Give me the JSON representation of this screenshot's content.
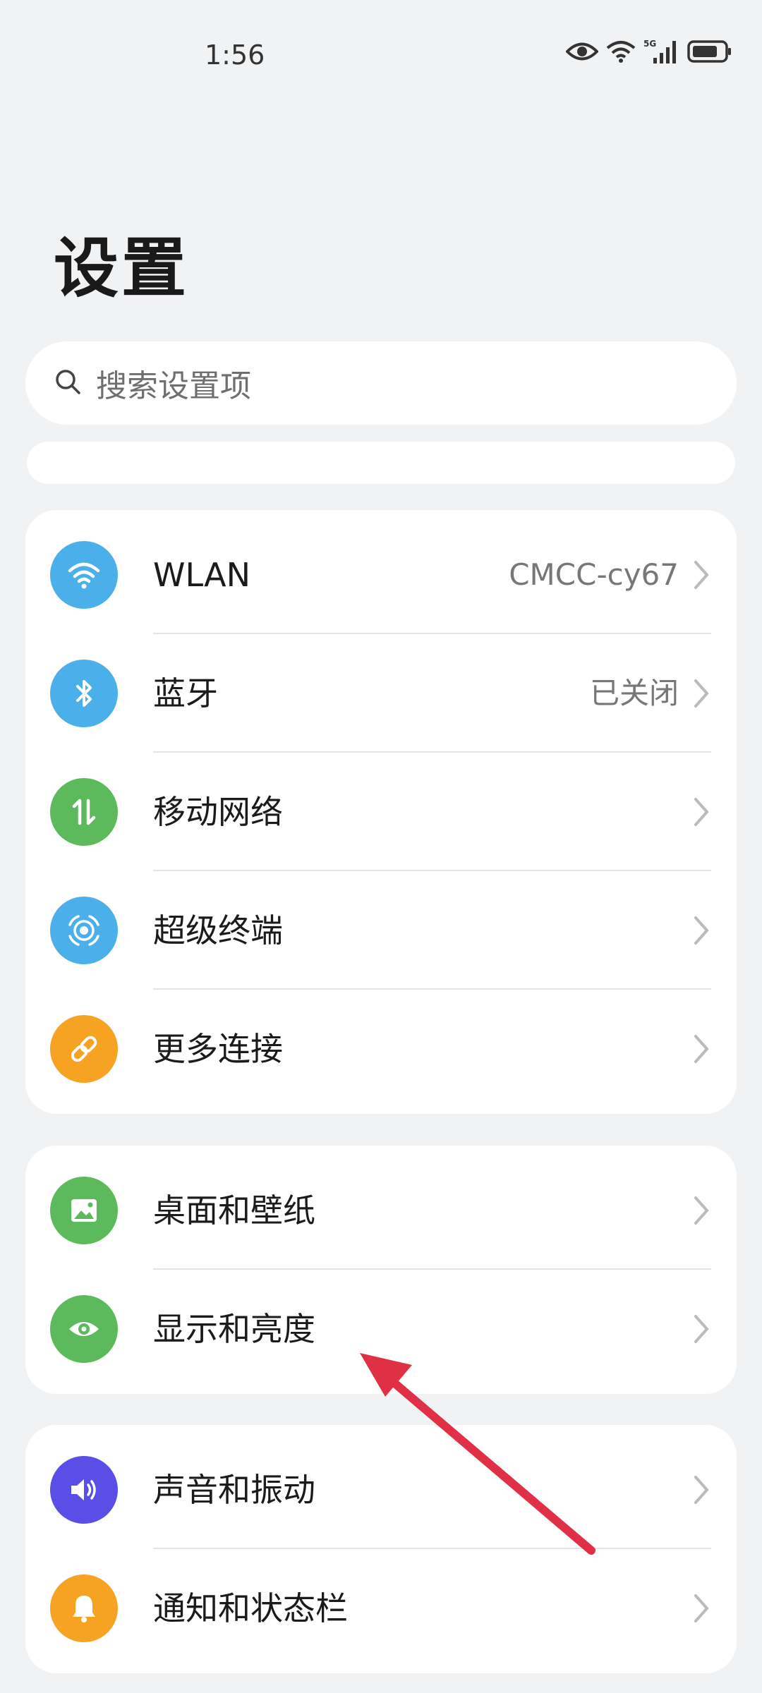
{
  "status_bar": {
    "time": "1:56",
    "network": "5G",
    "icons": [
      "eye-icon",
      "wifi-icon",
      "signal-icon",
      "battery-icon"
    ]
  },
  "page": {
    "title": "设置"
  },
  "search": {
    "placeholder": "搜索设置项"
  },
  "groups": [
    {
      "items": [
        {
          "label": "WLAN",
          "value": "CMCC-cy67",
          "icon": "wifi-icon",
          "color": "#4bb0ea"
        },
        {
          "label": "蓝牙",
          "value": "已关闭",
          "icon": "bluetooth-icon",
          "color": "#4bb0ea"
        },
        {
          "label": "移动网络",
          "value": "",
          "icon": "mobile-data-icon",
          "color": "#5cba5c"
        },
        {
          "label": "超级终端",
          "value": "",
          "icon": "super-device-icon",
          "color": "#4bb0ea"
        },
        {
          "label": "更多连接",
          "value": "",
          "icon": "link-icon",
          "color": "#f6a323"
        }
      ]
    },
    {
      "items": [
        {
          "label": "桌面和壁纸",
          "value": "",
          "icon": "wallpaper-icon",
          "color": "#5cba5c"
        },
        {
          "label": "显示和亮度",
          "value": "",
          "icon": "display-eye-icon",
          "color": "#5cba5c"
        }
      ]
    },
    {
      "items": [
        {
          "label": "声音和振动",
          "value": "",
          "icon": "sound-icon",
          "color": "#5a4ee6"
        },
        {
          "label": "通知和状态栏",
          "value": "",
          "icon": "bell-icon",
          "color": "#f6a323"
        }
      ]
    }
  ],
  "annotation": {
    "type": "arrow",
    "color": "#e03045"
  }
}
